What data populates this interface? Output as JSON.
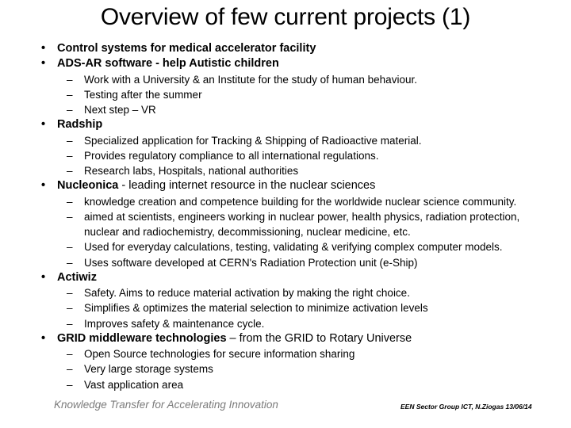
{
  "slide": {
    "title": "Overview of few current projects (1)",
    "bullet_char": "•",
    "dash_char": "–",
    "items": [
      {
        "text": "Control systems for medical accelerator facility",
        "sub": []
      },
      {
        "text": "ADS-AR software  - help Autistic children",
        "sub": [
          "Work with a University & an Institute for the study of human behaviour.",
          "Testing after the summer",
          "Next step – VR"
        ]
      },
      {
        "text": "Radship",
        "sub": [
          "Specialized application for Tracking & Shipping of Radioactive material.",
          "Provides regulatory compliance to all international regulations.",
          "Research labs, Hospitals, national authorities"
        ]
      },
      {
        "text": "Nucleonica",
        "text_regular": " - leading internet resource in the nuclear sciences",
        "sub": [
          "knowledge creation and competence building for the worldwide nuclear science community.",
          "aimed at scientists, engineers working in nuclear power, health physics, radiation protection, nuclear and radiochemistry, decommissioning, nuclear medicine, etc.",
          "Used for everyday calculations, testing, validating & verifying complex computer models.",
          "Uses software developed at CERN's Radiation Protection unit (e-Ship)"
        ]
      },
      {
        "text": "Actiwiz",
        "sub": [
          "Safety. Aims to reduce material activation by making the right choice.",
          "Simplifies & optimizes the material selection to minimize activation levels",
          "Improves safety & maintenance cycle."
        ]
      },
      {
        "text": "GRID middleware technologies",
        "text_regular": " – from  the GRID to Rotary Universe",
        "sub": [
          "Open Source technologies for secure information sharing",
          "Very large storage systems",
          "Vast application area"
        ]
      }
    ],
    "footer_left": "Knowledge Transfer for Accelerating Innovation",
    "footer_right": "EEN Sector Group ICT, N.Ziogas 13/06/14"
  }
}
